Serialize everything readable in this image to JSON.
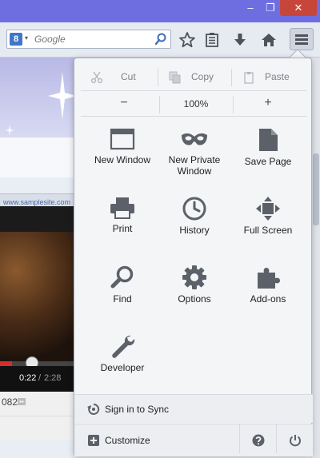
{
  "window": {
    "minimize_glyph": "–",
    "maximize_glyph": "❐",
    "close_glyph": "✕"
  },
  "toolbar": {
    "search_engine_letter": "8",
    "search_placeholder": "Google",
    "icons": [
      "star-icon",
      "reading-list-icon",
      "download-icon",
      "home-icon",
      "hamburger-menu-icon"
    ]
  },
  "background_page": {
    "address": "www.samplesite.com",
    "video_time_current": "0:22",
    "video_time_separator": "/",
    "video_time_total": "2:28",
    "video_progress": 0.15,
    "view_count_fragment": "082"
  },
  "menu": {
    "edit": {
      "cut": "Cut",
      "copy": "Copy",
      "paste": "Paste"
    },
    "zoom": {
      "out": "−",
      "level": "100%",
      "in": "+"
    },
    "items": [
      {
        "label": "New Window",
        "icon": "new-window-icon"
      },
      {
        "label": "New Private Window",
        "icon": "private-mask-icon"
      },
      {
        "label": "Save Page",
        "icon": "save-page-icon"
      },
      {
        "label": "Print",
        "icon": "printer-icon"
      },
      {
        "label": "History",
        "icon": "clock-icon"
      },
      {
        "label": "Full Screen",
        "icon": "fullscreen-arrows-icon"
      },
      {
        "label": "Find",
        "icon": "magnifier-icon"
      },
      {
        "label": "Options",
        "icon": "gear-icon"
      },
      {
        "label": "Add-ons",
        "icon": "puzzle-piece-icon"
      },
      {
        "label": "Developer",
        "icon": "wrench-icon"
      }
    ],
    "sync_label": "Sign in to Sync",
    "customize_label": "Customize",
    "help_icon": "question-icon",
    "quit_icon": "power-icon"
  },
  "colors": {
    "titlebar": "#6f6ee0",
    "close_button": "#c7463a",
    "panel_bg": "#f4f5f7",
    "icon_gray": "#5c6169"
  }
}
